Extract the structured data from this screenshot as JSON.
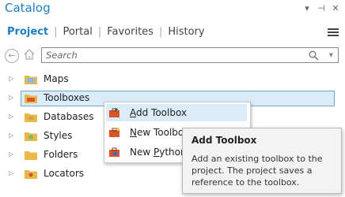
{
  "pane": {
    "title": "Catalog",
    "controls": {
      "menu_glyph": "▾",
      "pin_glyph": "⊣",
      "close_glyph": "✕"
    }
  },
  "tabs": [
    {
      "label": "Project",
      "active": true
    },
    {
      "label": "Portal"
    },
    {
      "label": "Favorites"
    },
    {
      "label": "History"
    }
  ],
  "search": {
    "placeholder": "Search"
  },
  "tree": [
    {
      "label": "Maps",
      "icon": "maps-folder-icon"
    },
    {
      "label": "Toolboxes",
      "icon": "toolboxes-folder-icon",
      "selected": true
    },
    {
      "label": "Databases",
      "icon": "databases-folder-icon"
    },
    {
      "label": "Styles",
      "icon": "styles-folder-icon"
    },
    {
      "label": "Folders",
      "icon": "folders-icon"
    },
    {
      "label": "Locators",
      "icon": "locators-folder-icon"
    }
  ],
  "context_menu": [
    {
      "label_pre": "",
      "label_key": "A",
      "label_post": "dd Toolbox",
      "hot": true
    },
    {
      "label_pre": "",
      "label_key": "N",
      "label_post": "ew Toolbox"
    },
    {
      "label_pre": "New ",
      "label_key": "P",
      "label_post": "ython Toolbox"
    }
  ],
  "tooltip": {
    "title": "Add Toolbox",
    "body": "Add an existing toolbox to the project. The project saves a reference to the toolbox."
  },
  "colors": {
    "accent": "#1a7fbf",
    "selection": "#dcebf8",
    "folder": "#e8b84a"
  }
}
